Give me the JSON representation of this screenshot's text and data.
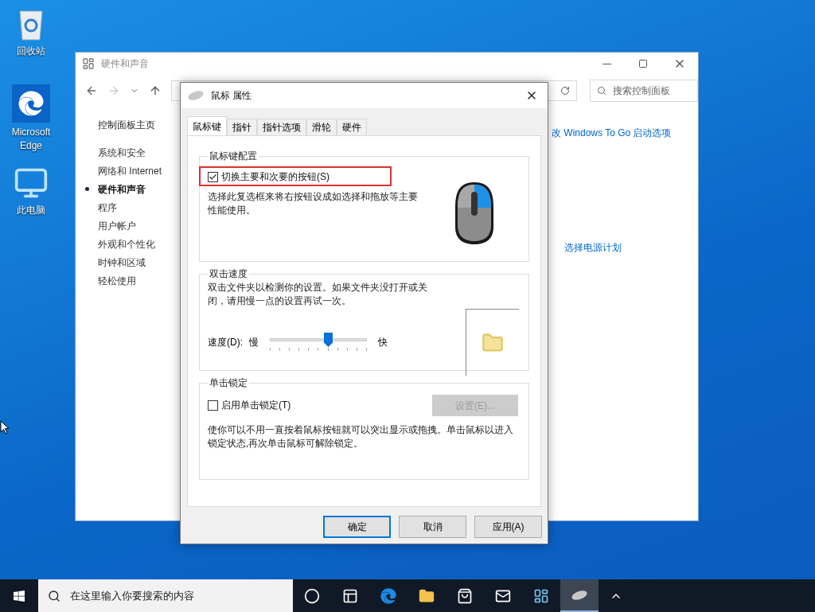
{
  "desktop_icons": [
    {
      "kind": "recycle",
      "label": "回收站"
    },
    {
      "kind": "edge",
      "label": "Microsoft Edge"
    },
    {
      "kind": "computer",
      "label": "此电脑"
    }
  ],
  "control_panel": {
    "title": "硬件和声音",
    "search_placeholder": "搜索控制面板",
    "home": "控制面板主页",
    "sidebar": [
      {
        "label": "系统和安全",
        "selected": false
      },
      {
        "label": "网络和 Internet",
        "selected": false
      },
      {
        "label": "硬件和声音",
        "selected": true
      },
      {
        "label": "程序",
        "selected": false
      },
      {
        "label": "用户帐户",
        "selected": false
      },
      {
        "label": "外观和个性化",
        "selected": false
      },
      {
        "label": "时钟和区域",
        "selected": false
      },
      {
        "label": "轻松使用",
        "selected": false
      }
    ],
    "links": [
      "改 Windows To Go 启动选项",
      "选择电源计划"
    ]
  },
  "dialog": {
    "title": "鼠标 属性",
    "tabs": [
      {
        "label": "鼠标键",
        "selected": true
      },
      {
        "label": "指针",
        "selected": false
      },
      {
        "label": "指针选项",
        "selected": false
      },
      {
        "label": "滑轮",
        "selected": false
      },
      {
        "label": "硬件",
        "selected": false
      }
    ],
    "button_config": {
      "legend": "鼠标键配置",
      "checkbox": {
        "label": "切换主要和次要的按钮(S)",
        "checked": true
      },
      "description": "选择此复选框来将右按钮设成如选择和拖放等主要性能使用。"
    },
    "double_click": {
      "legend": "双击速度",
      "description": "双击文件夹以检测你的设置。如果文件夹没打开或关闭，请用慢一点的设置再试一次。",
      "speed_label": "速度(D):",
      "slow": "慢",
      "fast": "快",
      "level": 0.6
    },
    "click_lock": {
      "legend": "单击锁定",
      "checkbox": {
        "label": "启用单击锁定(T)",
        "checked": false
      },
      "settings_button": {
        "label": "设置(E)...",
        "disabled": true
      },
      "description": "使你可以不用一直按着鼠标按钮就可以突出显示或拖拽。单击鼠标以进入锁定状态,再次单击鼠标可解除锁定。"
    },
    "buttons": [
      {
        "label": "确定",
        "default": true
      },
      {
        "label": "取消",
        "default": false
      },
      {
        "label": "应用(A)",
        "default": false
      }
    ]
  },
  "taskbar": {
    "search_placeholder": "在这里输入你要搜索的内容",
    "apps": [
      {
        "kind": "cortana",
        "selected": false
      },
      {
        "kind": "taskview",
        "selected": false
      },
      {
        "kind": "edge",
        "selected": false
      },
      {
        "kind": "explorer",
        "selected": false
      },
      {
        "kind": "store",
        "selected": false
      },
      {
        "kind": "mail",
        "selected": false
      },
      {
        "kind": "panel",
        "selected": false
      },
      {
        "kind": "mouse",
        "selected": true
      }
    ]
  }
}
